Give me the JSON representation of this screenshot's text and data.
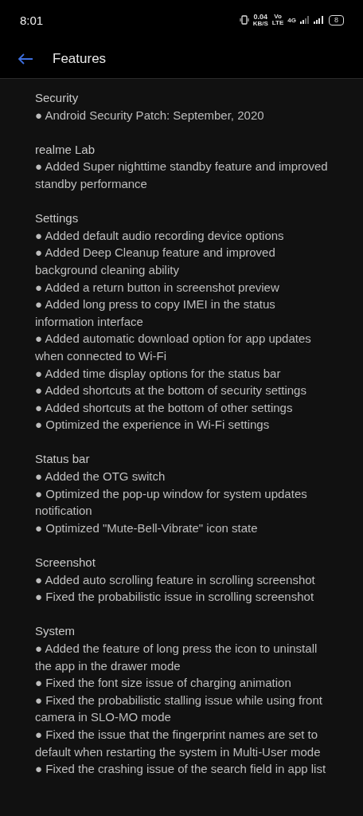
{
  "status_bar": {
    "time": "8:01",
    "speed": "0.04",
    "speed_unit": "KB/S",
    "volte_top": "Vo",
    "volte_bottom": "LTE",
    "network": "4G",
    "battery": "8"
  },
  "header": {
    "title": "Features"
  },
  "sections": [
    {
      "title": "Security",
      "items": [
        "● Android Security Patch: September, 2020"
      ]
    },
    {
      "title": "realme Lab",
      "items": [
        "● Added Super nighttime standby feature and improved standby performance"
      ]
    },
    {
      "title": "Settings",
      "items": [
        "● Added default audio recording device options",
        "● Added Deep Cleanup feature and improved background cleaning ability",
        "● Added a return button in screenshot preview",
        "● Added long press to copy IMEI in the status information interface",
        "● Added automatic download option for app updates when connected to Wi-Fi",
        "● Added time display options for the status bar",
        "● Added shortcuts at the bottom of security settings",
        "● Added shortcuts at the bottom of other settings",
        "● Optimized the experience in Wi-Fi settings"
      ]
    },
    {
      "title": "Status bar",
      "items": [
        "● Added the OTG switch",
        "● Optimized the pop-up window for system updates notification",
        "● Optimized \"Mute-Bell-Vibrate\" icon state"
      ]
    },
    {
      "title": "Screenshot",
      "items": [
        "● Added auto scrolling feature in scrolling screenshot",
        "● Fixed the probabilistic issue in scrolling screenshot"
      ]
    },
    {
      "title": "System",
      "items": [
        "● Added the feature of long press the icon to uninstall the app in the drawer mode",
        "● Fixed the font size issue of charging animation",
        "● Fixed the probabilistic stalling issue while using front camera in SLO-MO mode",
        "● Fixed the issue that the fingerprint names are set to default when restarting the system in Multi-User mode",
        "● Fixed the crashing issue of the search field in app list"
      ]
    }
  ]
}
